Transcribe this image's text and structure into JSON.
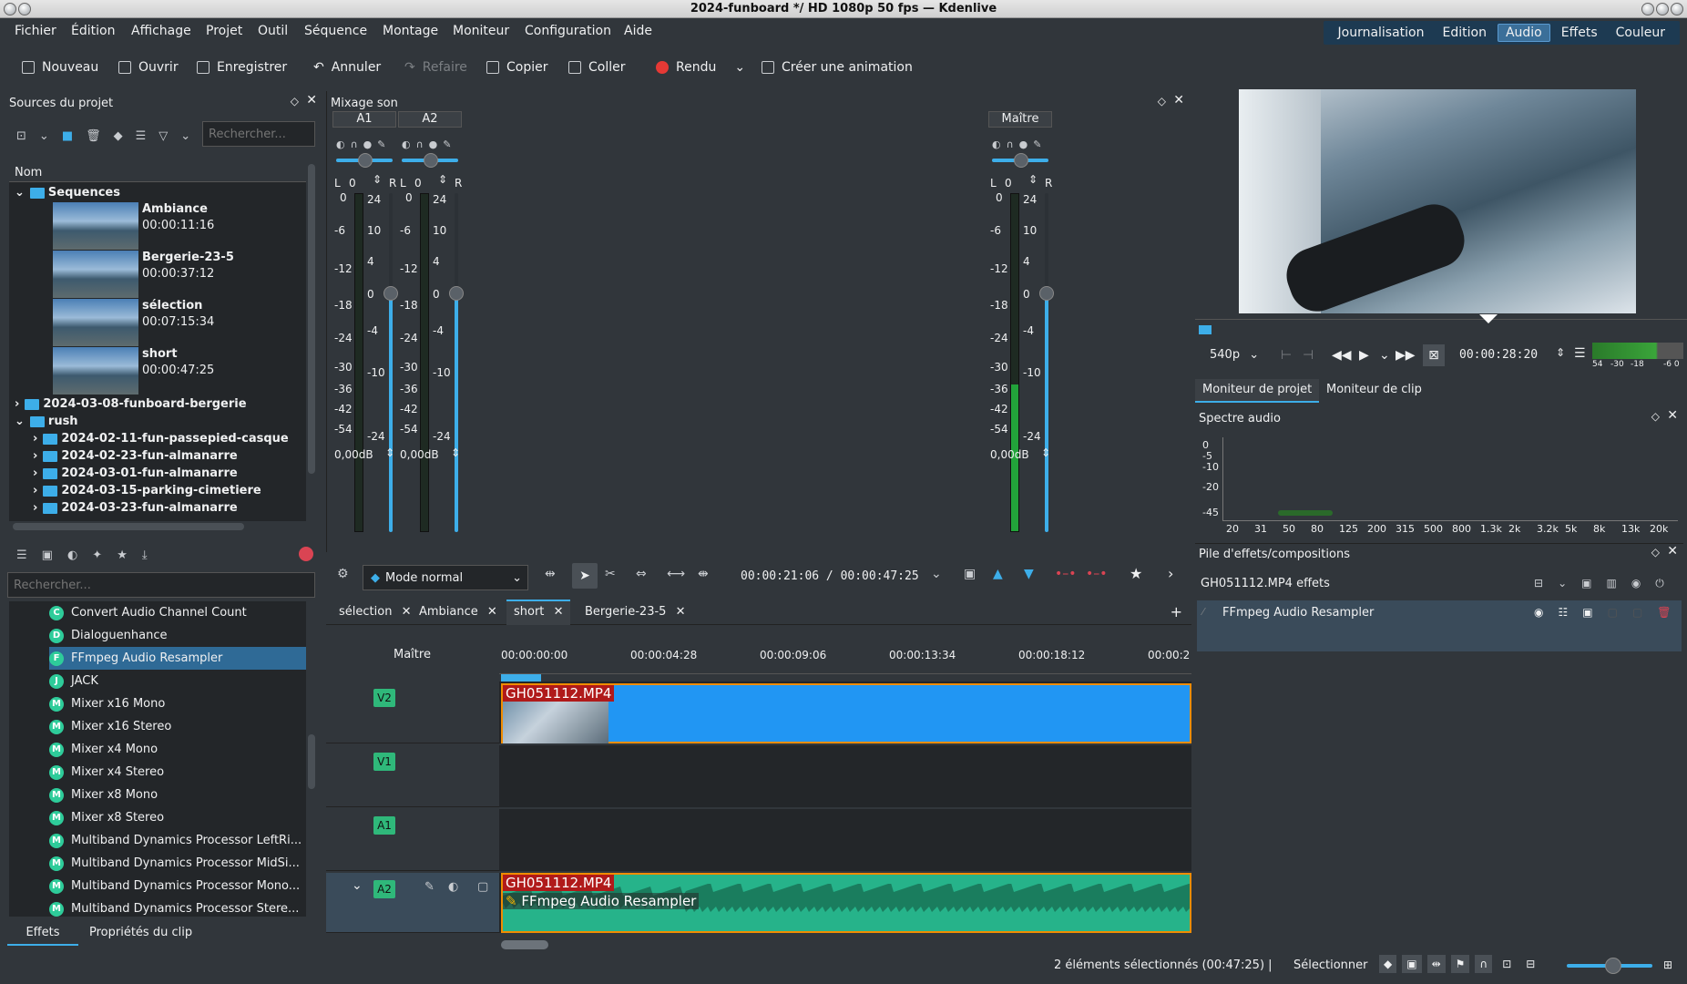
{
  "window": {
    "title": "2024-funboard */ HD 1080p 50 fps — Kdenlive"
  },
  "menu": [
    "Fichier",
    "Édition",
    "Affichage",
    "Projet",
    "Outil",
    "Séquence",
    "Montage",
    "Moniteur",
    "Configuration",
    "Aide"
  ],
  "activities": [
    {
      "label": "Journalisation"
    },
    {
      "label": "Edition"
    },
    {
      "label": "Audio",
      "selected": true
    },
    {
      "label": "Effets"
    },
    {
      "label": "Couleur"
    }
  ],
  "toolbar": {
    "new": "Nouveau",
    "open": "Ouvrir",
    "save": "Enregistrer",
    "undo": "Annuler",
    "redo": "Refaire",
    "copy": "Copier",
    "paste": "Coller",
    "render": "Rendu",
    "animation": "Créer une animation"
  },
  "project_bin": {
    "title": "Sources du projet",
    "search_placeholder": "Rechercher...",
    "column": "Nom",
    "sequences_folder": "Sequences",
    "clips": [
      {
        "name": "Ambiance",
        "duration": "00:00:11:16"
      },
      {
        "name": "Bergerie-23-5",
        "duration": "00:00:37:12"
      },
      {
        "name": "sélection",
        "duration": "00:07:15:34"
      },
      {
        "name": "short",
        "duration": "00:00:47:25"
      }
    ],
    "folder2": "2024-03-08-funboard-bergerie",
    "rush_folder": "rush",
    "rush_items": [
      "2024-02-11-fun-passepied-casque",
      "2024-02-23-fun-almanarre",
      "2024-03-01-fun-almanarre",
      "2024-03-15-parking-cimetiere",
      "2024-03-23-fun-almanarre"
    ]
  },
  "effects_panel": {
    "search_placeholder": "Rechercher...",
    "items": [
      {
        "b": "C",
        "n": "Convert Audio Channel Count"
      },
      {
        "b": "D",
        "n": "Dialoguenhance"
      },
      {
        "b": "F",
        "n": "FFmpeg Audio Resampler",
        "selected": true
      },
      {
        "b": "J",
        "n": "JACK"
      },
      {
        "b": "M",
        "n": "Mixer x16 Mono"
      },
      {
        "b": "M",
        "n": "Mixer x16 Stereo"
      },
      {
        "b": "M",
        "n": "Mixer x4 Mono"
      },
      {
        "b": "M",
        "n": "Mixer x4 Stereo"
      },
      {
        "b": "M",
        "n": "Mixer x8 Mono"
      },
      {
        "b": "M",
        "n": "Mixer x8 Stereo"
      },
      {
        "b": "M",
        "n": "Multiband Dynamics Processor LeftRi..."
      },
      {
        "b": "M",
        "n": "Multiband Dynamics Processor MidSi..."
      },
      {
        "b": "M",
        "n": "Multiband Dynamics Processor Mono..."
      },
      {
        "b": "M",
        "n": "Multiband Dynamics Processor Stere..."
      }
    ],
    "tabs": [
      "Effets",
      "Propriétés du clip"
    ]
  },
  "mixer": {
    "title": "Mixage son",
    "channels": [
      "A1",
      "A2"
    ],
    "master": "Maître",
    "lr": [
      "L",
      "R"
    ],
    "pan_value": "0",
    "db_value": "0,00dB",
    "scale_left": [
      "0",
      "-6",
      "-12",
      "-18",
      "-24",
      "-30",
      "-36",
      "-42",
      "-54"
    ],
    "scale_right": [
      "24",
      "10",
      "4",
      "0",
      "-4",
      "-10",
      "-24"
    ]
  },
  "timeline_toolbar": {
    "mode": "Mode normal",
    "timecode": "00:00:21:06 / 00:00:47:25"
  },
  "timeline": {
    "tabs": [
      "sélection",
      "Ambiance",
      "short",
      "Bergerie-23-5"
    ],
    "active_tab": "short",
    "master_label": "Maître",
    "ruler": [
      "00:00:00:00",
      "00:00:04:28",
      "00:00:09:06",
      "00:00:13:34",
      "00:00:18:12",
      "00:00:2"
    ],
    "tracks": [
      "V2",
      "V1",
      "A1",
      "A2"
    ],
    "clip_name": "GH051112.MP4",
    "audio_effect": "FFmpeg Audio Resampler"
  },
  "monitor": {
    "resolution": "540p",
    "timecode": "00:00:28:20",
    "meter_labels": [
      "54",
      "-30",
      "-18",
      "-6 0"
    ],
    "tabs": [
      "Moniteur de projet",
      "Moniteur de clip"
    ]
  },
  "spectrum": {
    "title": "Spectre audio",
    "y": [
      "0",
      "-5",
      "-10",
      "-20",
      "-45"
    ],
    "x": [
      "20",
      "31",
      "50",
      "80",
      "125",
      "200",
      "315",
      "500",
      "800",
      "1.3k",
      "2k",
      "3.2k",
      "5k",
      "8k",
      "13k",
      "20k"
    ]
  },
  "effect_stack": {
    "title": "Pile d'effets/compositions",
    "clip_effects": "GH051112.MP4 effets",
    "effect": "FFmpeg Audio Resampler"
  },
  "status": {
    "text": "2 éléments sélectionnés (00:47:25) |",
    "mode": "Sélectionner"
  },
  "colors": {
    "accent": "#3daee9",
    "clip_blue": "#2196f3",
    "audio_green": "#26b38a",
    "clip_label": "#b01a1a"
  }
}
